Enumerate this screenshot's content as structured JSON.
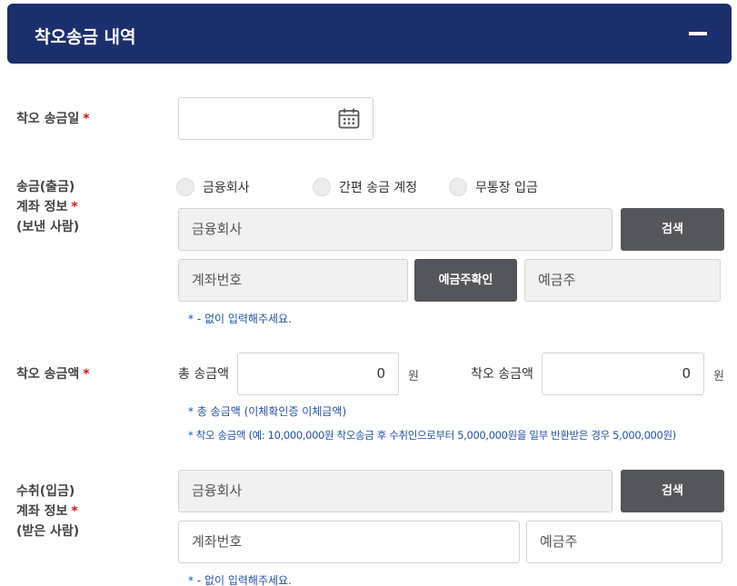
{
  "header": {
    "title": "착오송금 내역"
  },
  "date_row": {
    "label": "착오 송금일",
    "required": "*"
  },
  "sender": {
    "label_lines": [
      "송금(출금)",
      "계좌 정보",
      "(보낸 사람)"
    ],
    "required": "*",
    "radio_options": [
      "금융회사",
      "간편 송금 계정",
      "무통장 입금"
    ],
    "bank_placeholder": "금융회사",
    "search_label": "검색",
    "account_placeholder": "계좌번호",
    "verify_label": "예금주확인",
    "holder_placeholder": "예금주",
    "note": "* - 없이 입력해주세요."
  },
  "amount": {
    "label": "착오 송금액",
    "required": "*",
    "total_label": "총 송금액",
    "total_value": "0",
    "total_unit": "원",
    "mistaken_label": "착오 송금액",
    "mistaken_value": "0",
    "mistaken_unit": "원",
    "notes": [
      "* 총 송금액 (이체확인증 이체금액)",
      "* 착오 송금액 (예: 10,000,000원 착오송금 후 수취인으로부터 5,000,000원을 일부 반환받은 경우 5,000,000원)"
    ]
  },
  "receiver": {
    "label_lines": [
      "수취(입금)",
      "계좌 정보",
      "(받은 사람)"
    ],
    "required": "*",
    "bank_placeholder": "금융회사",
    "search_label": "검색",
    "account_placeholder": "계좌번호",
    "holder_placeholder": "예금주",
    "note": "* - 없이 입력해주세요."
  },
  "icons": {
    "calendar": "calendar-icon",
    "collapse": "minus-icon"
  },
  "colors": {
    "header_bg": "#1c2f6d",
    "button_bg": "#55565b",
    "required": "#d7141a",
    "note": "#2550a8"
  }
}
